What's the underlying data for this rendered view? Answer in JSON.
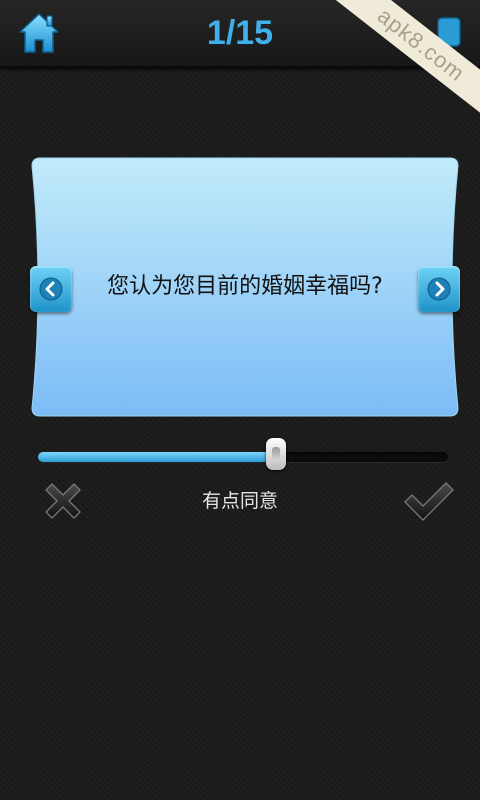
{
  "header": {
    "progress_text": "1/15",
    "home_icon": "home-icon",
    "share_icon": "share-icon"
  },
  "watermark": {
    "text": "apk8.com"
  },
  "card": {
    "question": "您认为您目前的婚姻幸福吗?",
    "prev_icon": "chevron-left-icon",
    "next_icon": "chevron-right-icon"
  },
  "slider": {
    "value": 0.58
  },
  "answer": {
    "label": "有点同意"
  },
  "actions": {
    "reject_icon": "x-icon",
    "accept_icon": "check-icon"
  },
  "colors": {
    "accent": "#3fb0ea",
    "background": "#1b1b1b",
    "card_top": "#bfe9f8",
    "card_bottom": "#7fbff7"
  }
}
